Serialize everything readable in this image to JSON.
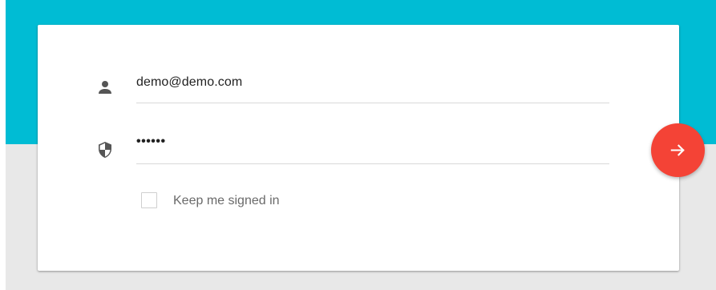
{
  "login_form": {
    "email": {
      "icon": "person-icon",
      "value": "demo@demo.com"
    },
    "password": {
      "icon": "shield-icon",
      "value_masked": "••••••"
    },
    "remember_me": {
      "label": "Keep me signed in",
      "checked": false
    },
    "submit": {
      "icon": "arrow-right-icon"
    }
  },
  "colors": {
    "banner": "#00bcd4",
    "background": "#e8e8e8",
    "card": "#ffffff",
    "submit_button": "#f44336",
    "icon": "#555555"
  }
}
